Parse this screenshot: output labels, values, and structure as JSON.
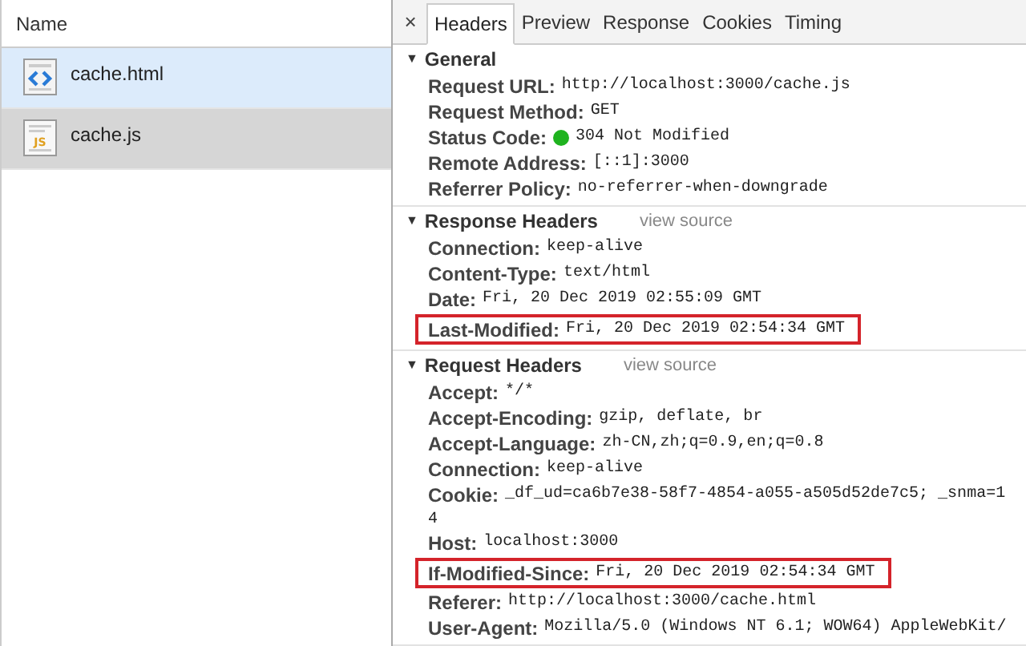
{
  "requests": {
    "column_header": "Name",
    "items": [
      {
        "name": "cache.html",
        "kind": "html",
        "selected": false,
        "hovered": true
      },
      {
        "name": "cache.js",
        "kind": "js",
        "icon_text": "JS",
        "selected": true,
        "hovered": false
      }
    ]
  },
  "close_glyph": "×",
  "toggle_glyph": "▼",
  "tabs": [
    {
      "label": "Headers",
      "selected": true
    },
    {
      "label": "Preview",
      "selected": false
    },
    {
      "label": "Response",
      "selected": false
    },
    {
      "label": "Cookies",
      "selected": false
    },
    {
      "label": "Timing",
      "selected": false
    }
  ],
  "sections": [
    {
      "title": "General",
      "expanded": true,
      "rows": [
        {
          "name": "Request URL:",
          "value": "http://localhost:3000/cache.js",
          "highlighted": false
        },
        {
          "name": "Request Method:",
          "value": "GET",
          "highlighted": false
        },
        {
          "name": "Status Code:",
          "value": "304 Not Modified",
          "highlighted": false,
          "color": "#1fb31f"
        },
        {
          "name": "Remote Address:",
          "value": "[::1]:3000",
          "highlighted": false
        },
        {
          "name": "Referrer Policy:",
          "value": "no-referrer-when-downgrade",
          "highlighted": false
        }
      ]
    },
    {
      "title": "Response Headers",
      "link": "view source",
      "expanded": true,
      "rows": [
        {
          "name": "Connection:",
          "value": "keep-alive",
          "highlighted": false
        },
        {
          "name": "Content-Type:",
          "value": "text/html",
          "highlighted": false
        },
        {
          "name": "Date:",
          "value": "Fri, 20 Dec 2019 02:55:09 GMT",
          "highlighted": false
        },
        {
          "name": "Last-Modified:",
          "value": "Fri, 20 Dec 2019 02:54:34 GMT",
          "highlighted": true
        }
      ]
    },
    {
      "title": "Request Headers",
      "link": "view source",
      "expanded": true,
      "rows": [
        {
          "name": "Accept:",
          "value": "*/*",
          "highlighted": false
        },
        {
          "name": "Accept-Encoding:",
          "value": "gzip, deflate, br",
          "highlighted": false
        },
        {
          "name": "Accept-Language:",
          "value": "zh-CN,zh;q=0.9,en;q=0.8",
          "highlighted": false
        },
        {
          "name": "Connection:",
          "value": "keep-alive",
          "highlighted": false
        },
        {
          "name": "Cookie:",
          "value": "_df_ud=ca6b7e38-58f7-4854-a055-a505d52de7c5; _snma=1",
          "continuation": "4",
          "highlighted": false
        },
        {
          "name": "Host:",
          "value": "localhost:3000",
          "highlighted": false
        },
        {
          "name": "If-Modified-Since:",
          "value": "Fri, 20 Dec 2019 02:54:34 GMT",
          "highlighted": true
        },
        {
          "name": "Referer:",
          "value": "http://localhost:3000/cache.html",
          "highlighted": false
        },
        {
          "name": "User-Agent:",
          "value": "Mozilla/5.0 (Windows NT 6.1; WOW64) AppleWebKit/",
          "highlighted": false
        }
      ]
    }
  ]
}
